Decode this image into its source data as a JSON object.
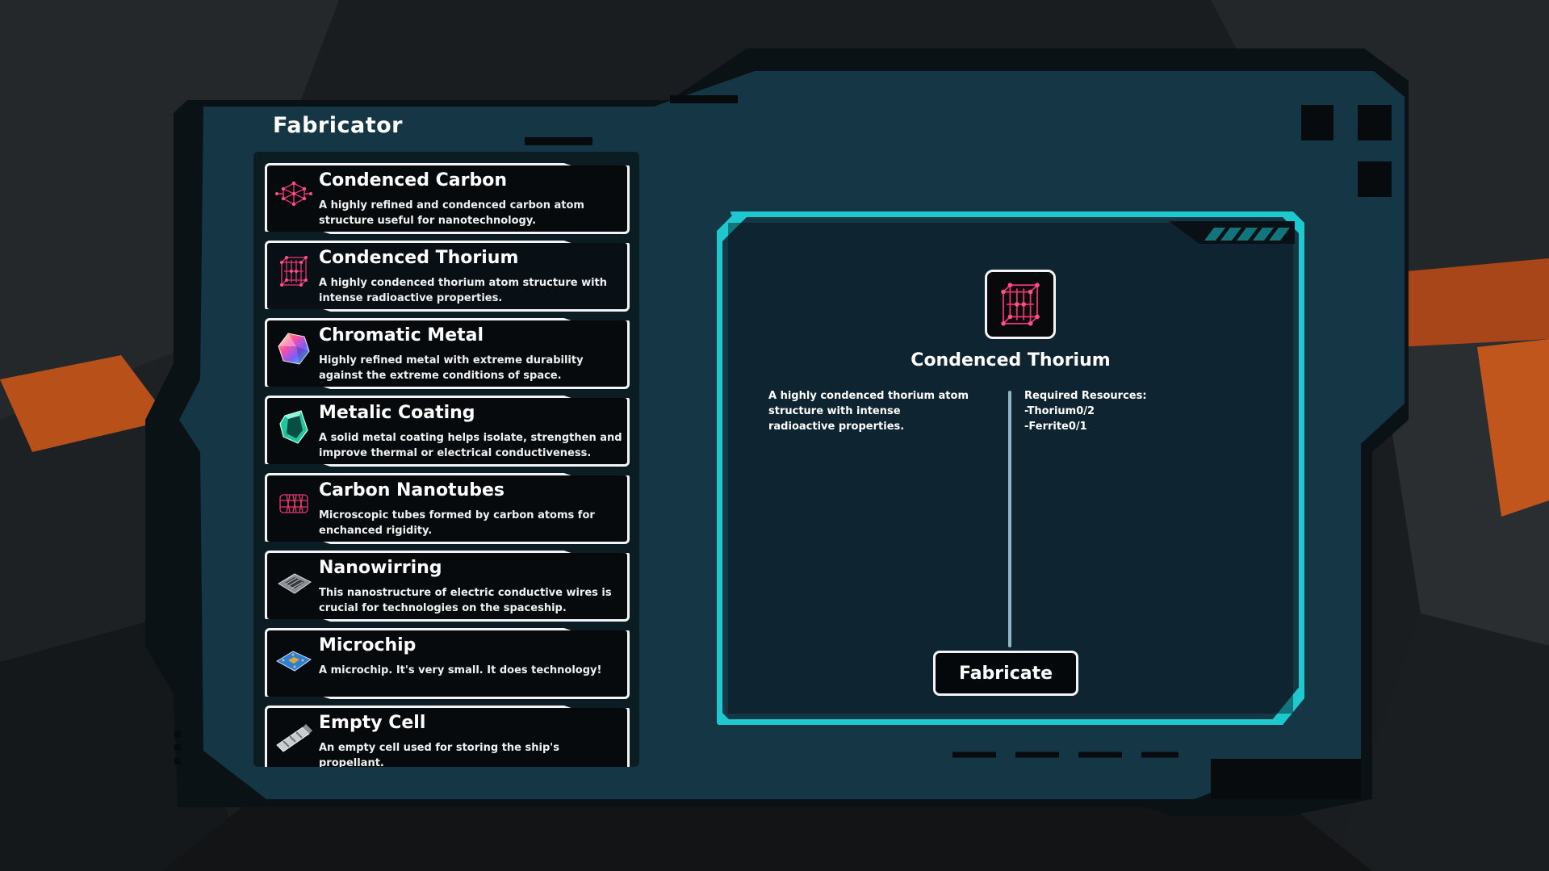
{
  "window": {
    "title": "Fabricator"
  },
  "items": [
    {
      "name": "Condenced Carbon",
      "desc": "A highly refined and condenced carbon atom structure useful for nanotechnology.",
      "icon": "carbon-lattice-icon"
    },
    {
      "name": "Condenced Thorium",
      "desc": "A highly condenced thorium atom structure with intense radioactive properties.",
      "icon": "thorium-cube-icon"
    },
    {
      "name": "Chromatic Metal",
      "desc": "Highly refined metal with extreme durability against the extreme conditions of space.",
      "icon": "chromatic-crystal-icon"
    },
    {
      "name": "Metalic Coating",
      "desc": "A solid metal coating helps isolate, strengthen and improve thermal or electrical conductiveness.",
      "icon": "metal-coating-icon"
    },
    {
      "name": "Carbon Nanotubes",
      "desc": "Microscopic tubes formed by carbon atoms for enchanced rigidity.",
      "icon": "nanotube-icon"
    },
    {
      "name": "Nanowirring",
      "desc": "This nanostructure of electric conductive wires is crucial for technologies on the spaceship.",
      "icon": "nanowire-chip-icon"
    },
    {
      "name": "Microchip",
      "desc": "A microchip. It's very small. It does technology!",
      "icon": "microchip-icon"
    },
    {
      "name": "Empty Cell",
      "desc": "An empty cell used for storing the ship's propellant.",
      "icon": "fuel-cell-icon"
    }
  ],
  "selected": {
    "name": "Condenced Thorium",
    "desc": "A highly condenced thorium atom structure with intense radioactive properties.",
    "icon": "thorium-cube-icon",
    "required_label": "Required Resources:",
    "resources": [
      "-Thorium0/2",
      "-Ferrite0/1"
    ]
  },
  "fabricate_label": "Fabricate",
  "colors": {
    "accent": "#1ec8cf",
    "frame": "#0b1216",
    "panel": "#133847",
    "border": "#f2f4f5"
  }
}
